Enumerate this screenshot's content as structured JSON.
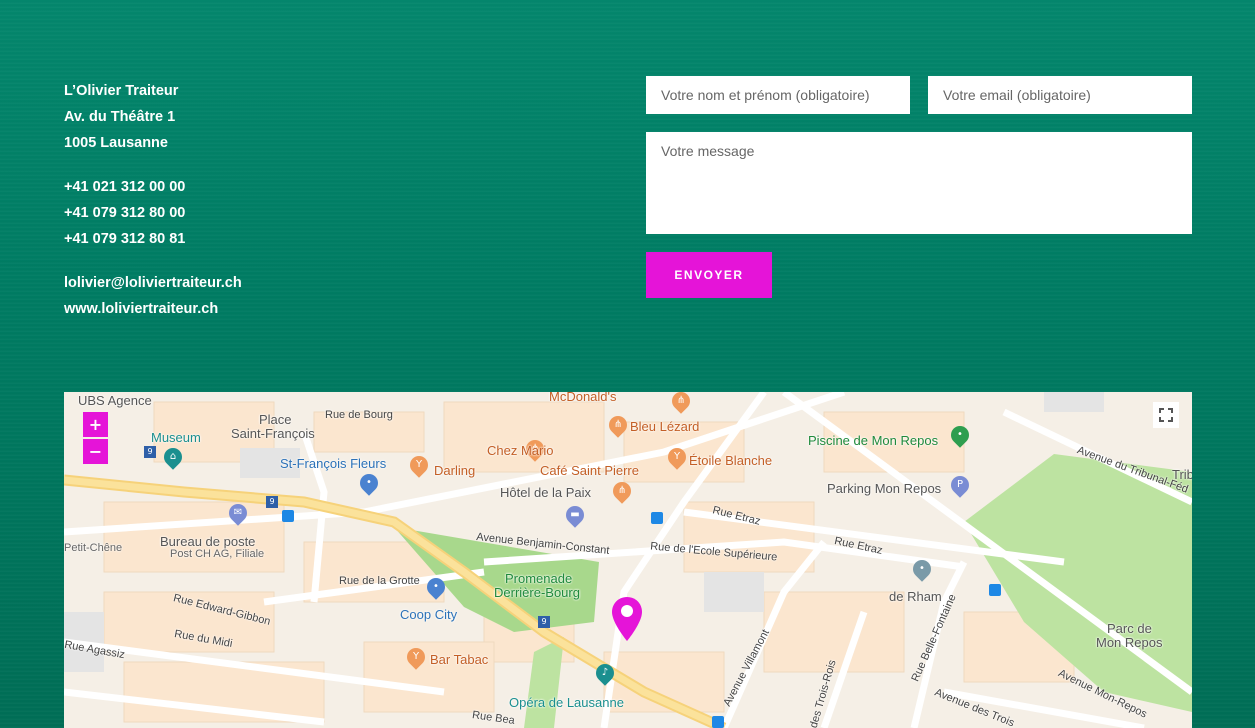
{
  "contact": {
    "address": [
      "L’Olivier Traiteur",
      "Av. du Théâtre 1",
      "1005 Lausanne"
    ],
    "phones": [
      "+41 021 312 00 00",
      "+41 079 312 80 00",
      "+41 079 312 80 81"
    ],
    "web": [
      "lolivier@loliviertraiteur.ch",
      "www.loliviertraiteur.ch"
    ]
  },
  "form": {
    "name_placeholder": "Votre nom et prénom (obligatoire)",
    "email_placeholder": "Votre email (obligatoire)",
    "message_placeholder": "Votre message",
    "submit_label": "ENVOYER"
  },
  "map": {
    "zoom_in": "+",
    "zoom_out": "−",
    "marker_color": "#e514d8",
    "places": {
      "ubs": "UBS Agence",
      "museum": "Museum",
      "place_st_francois_1": "Place",
      "place_st_francois_2": "Saint-François",
      "st_francois_fleurs": "St-François Fleurs",
      "bureau_poste": "Bureau de poste",
      "post_filiale": "Post CH AG, Filiale",
      "petit_chene": "Petit-Chêne",
      "mcdonalds": "McDonald's",
      "chez_mario": "Chez Mario",
      "bleu_lezard": "Bleu Lézard",
      "darling": "Darling",
      "cafe_st_pierre": "Café Saint Pierre",
      "etoile_blanche": "Étoile Blanche",
      "hotel_paix": "Hôtel de la Paix",
      "piscine": "Piscine de Mon Repos",
      "parking": "Parking Mon Repos",
      "promenade_1": "Promenade",
      "promenade_2": "Derrière-Bourg",
      "coop": "Coop City",
      "bar_tabac": "Bar Tabac",
      "opera": "Opéra de Lausanne",
      "de_rham": "de Rham",
      "parc_1": "Parc de",
      "parc_2": "Mon Repos",
      "trib": "Trib"
    },
    "streets": {
      "rue_bourg": "Rue de Bourg",
      "av_benjamin": "Avenue Benjamin-Constant",
      "rue_ecole": "Rue de l'Ecole Supérieure",
      "rue_etraz_1": "Rue Etraz",
      "rue_etraz_2": "Rue Etraz",
      "rue_grotte": "Rue de la Grotte",
      "rue_edward": "Rue Edward-Gibbon",
      "rue_midi": "Rue du Midi",
      "rue_agassiz": "Rue Agassiz",
      "av_villamont": "Avenue Villamont",
      "rue_belle_fontaine": "Rue Belle-Fontaine",
      "av_tribunal": "Avenue du Tribunal-Féd",
      "av_mon_repos": "Avenue Mon-Repos",
      "av_trois_rois": "Avenue des Trois",
      "ch_trois_rois": "des Trois-Rois",
      "rue_bea": "Rue Bea"
    },
    "badges": {
      "b1": "9",
      "b2": "9",
      "b3": "9"
    }
  }
}
